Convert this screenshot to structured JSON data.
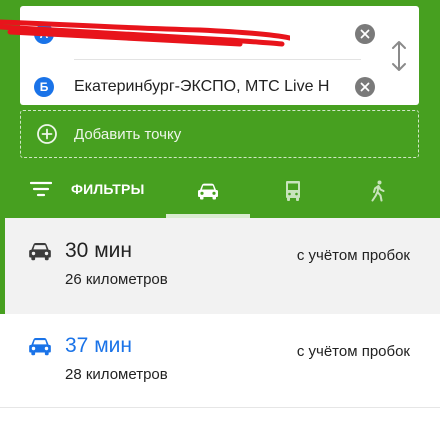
{
  "route": {
    "point_a": {
      "badge": "А",
      "value": "",
      "redacted": true
    },
    "point_b": {
      "badge": "Б",
      "value": "Екатеринбург-ЭКСПО, МТС Live H"
    }
  },
  "add_point": {
    "label": "Добавить точку"
  },
  "filters": {
    "label": "ФИЛЬТРЫ"
  },
  "modes": [
    {
      "name": "car",
      "icon": "car-icon",
      "active": true
    },
    {
      "name": "transit",
      "icon": "bus-icon",
      "active": false
    },
    {
      "name": "walk",
      "icon": "walk-icon",
      "active": false
    }
  ],
  "results": [
    {
      "duration": "30 мин",
      "distance": "26 километров",
      "traffic": "с учётом пробок",
      "selected": true
    },
    {
      "duration": "37 мин",
      "distance": "28 километров",
      "traffic": "с учётом пробок",
      "selected": false
    }
  ],
  "colors": {
    "brand_green": "#47a020",
    "badge_blue": "#1a73e8",
    "selected_bg": "#f2f2f2",
    "redaction": "#e8141b"
  }
}
